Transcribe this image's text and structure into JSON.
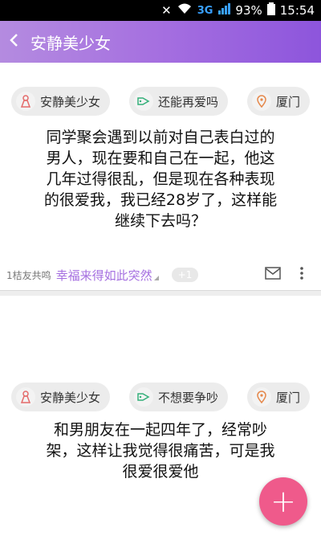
{
  "status_bar": {
    "network": "3G",
    "battery": "93%",
    "time": "15:54"
  },
  "app_bar": {
    "back_icon": "chevron-left",
    "title": "安静美少女"
  },
  "posts": [
    {
      "tags": [
        {
          "icon": "person-icon",
          "label": "安静美少女"
        },
        {
          "icon": "tag-icon",
          "label": "还能再爱吗"
        },
        {
          "icon": "location-icon",
          "label": "厦门"
        }
      ],
      "text_lines": [
        "同学聚会遇到以前对自己表白过的",
        "男人，现在要和自己在一起，他这",
        "几年过得很乱，但是现在各种表现",
        "的很爱我，我已经28岁了，这样能",
        "继续下去吗？"
      ],
      "resonance": "1桔友共鸣",
      "happiness": "幸福来得如此突然",
      "plus_one": "+1"
    },
    {
      "tags": [
        {
          "icon": "person-icon",
          "label": "安静美少女"
        },
        {
          "icon": "tag-icon",
          "label": "不想要争吵"
        },
        {
          "icon": "location-icon",
          "label": "厦门"
        }
      ],
      "text_lines": [
        "和男朋友在一起四年了，经常吵",
        "架，这样让我觉得很痛苦，可是我",
        "很爱很爱他"
      ]
    }
  ],
  "fab": {
    "label": "+"
  },
  "colors": {
    "accent": "#a56fe0",
    "fab": "#ef5a8b"
  }
}
